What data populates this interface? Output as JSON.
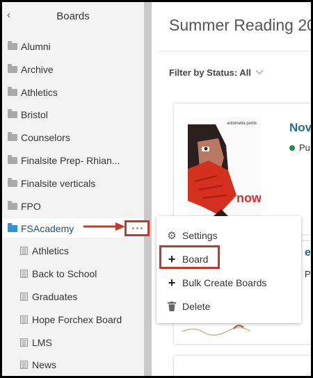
{
  "sidebar": {
    "title": "Boards",
    "back_glyph": "‹",
    "items": [
      {
        "label": "Alumni"
      },
      {
        "label": "Archive"
      },
      {
        "label": "Athletics"
      },
      {
        "label": "Bristol"
      },
      {
        "label": "Counselors"
      },
      {
        "label": "Finalsite Prep- Rhian..."
      },
      {
        "label": "Finalsite verticals"
      },
      {
        "label": "FPO"
      },
      {
        "label": "FSAcademy"
      }
    ],
    "subitems": [
      {
        "label": "Athletics"
      },
      {
        "label": "Back to School"
      },
      {
        "label": "Graduates"
      },
      {
        "label": "Hope Forchex Board"
      },
      {
        "label": "LMS"
      },
      {
        "label": "News"
      }
    ],
    "active_item": "FSAcademy",
    "folder_color": "#a9a9a9",
    "active_folder_color": "#2f93d8"
  },
  "main": {
    "page_title": "Summer Reading 20",
    "filter_label": "Filter by Status: All",
    "card1": {
      "cover_author": "antoinetta portis",
      "cover_word": "now",
      "title": "Nov",
      "status": "Pu",
      "status_color": "#1d8f4e"
    },
    "card2": {
      "title_peek": "e",
      "status_peek": "P"
    }
  },
  "menu": {
    "items": [
      {
        "label": "Settings",
        "icon": "gear-icon"
      },
      {
        "label": "Board",
        "icon": "plus-icon"
      },
      {
        "label": "Bulk Create Boards",
        "icon": "plus-icon"
      },
      {
        "label": "Delete",
        "icon": "trash-icon"
      }
    ]
  },
  "annotation_color": "#c0392b"
}
